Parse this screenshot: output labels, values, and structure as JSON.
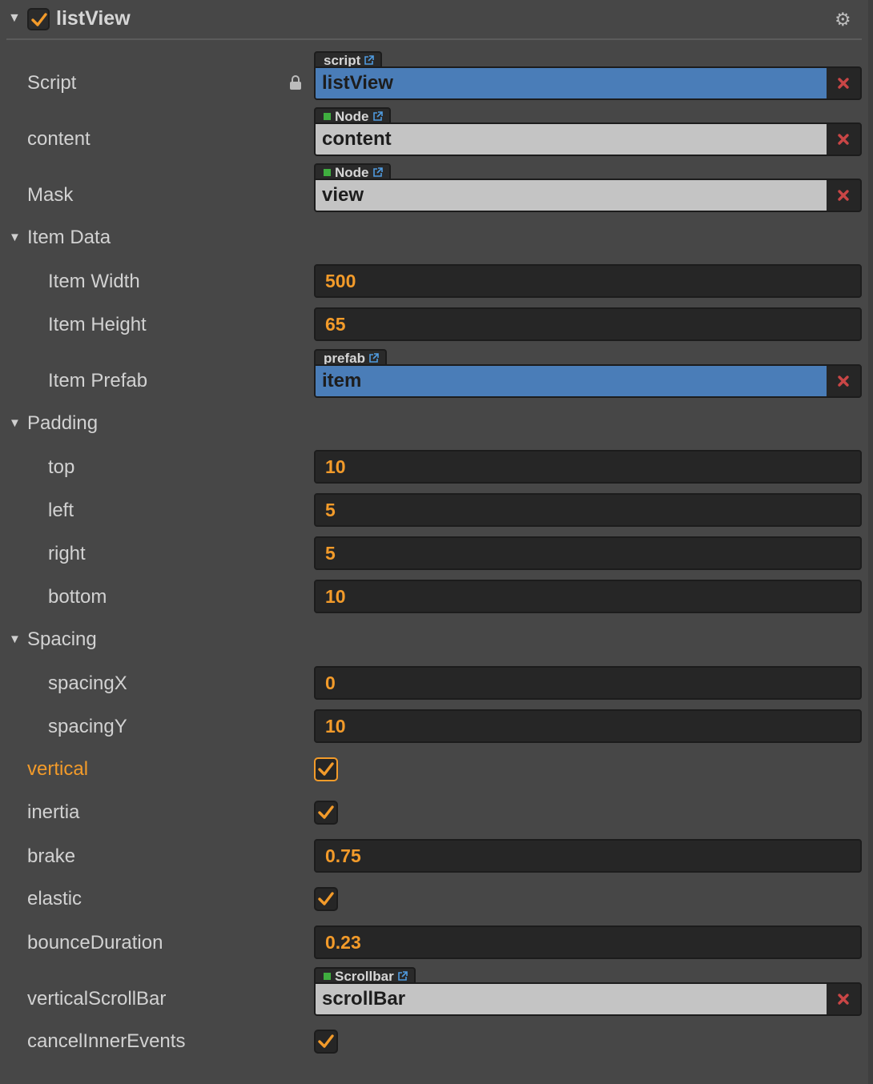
{
  "component": {
    "title": "listView",
    "enabled": true
  },
  "colors": {
    "accent": "#f39b2a",
    "object_ref": "#4a7db8",
    "node_ref": "#c4c4c4",
    "remove": "#c94646"
  },
  "properties": {
    "script": {
      "label": "Script",
      "type_label": "script",
      "value": "listView"
    },
    "content": {
      "label": "content",
      "type_label": "Node",
      "value": "content"
    },
    "mask": {
      "label": "Mask",
      "type_label": "Node",
      "value": "view"
    }
  },
  "item_data": {
    "label": "Item Data",
    "item_width": {
      "label": "Item Width",
      "value": "500"
    },
    "item_height": {
      "label": "Item Height",
      "value": "65"
    },
    "item_prefab": {
      "label": "Item Prefab",
      "type_label": "prefab",
      "value": "item"
    }
  },
  "padding": {
    "label": "Padding",
    "top": {
      "label": "top",
      "value": "10"
    },
    "left": {
      "label": "left",
      "value": "5"
    },
    "right": {
      "label": "right",
      "value": "5"
    },
    "bottom": {
      "label": "bottom",
      "value": "10"
    }
  },
  "spacing": {
    "label": "Spacing",
    "spacing_x": {
      "label": "spacingX",
      "value": "0"
    },
    "spacing_y": {
      "label": "spacingY",
      "value": "10"
    }
  },
  "options": {
    "vertical": {
      "label": "vertical",
      "checked": true
    },
    "inertia": {
      "label": "inertia",
      "checked": true
    },
    "brake": {
      "label": "brake",
      "value": "0.75"
    },
    "elastic": {
      "label": "elastic",
      "checked": true
    },
    "bounce_duration": {
      "label": "bounceDuration",
      "value": "0.23"
    },
    "vertical_scroll_bar": {
      "label": "verticalScrollBar",
      "type_label": "Scrollbar",
      "value": "scrollBar"
    },
    "cancel_inner_events": {
      "label": "cancelInnerEvents",
      "checked": true
    }
  },
  "icons": {
    "collapse": "triangle-down-icon",
    "settings": "gear-icon",
    "lock": "lock-icon",
    "external": "external-link-icon",
    "remove": "x-remove-icon",
    "check": "checkmark-icon"
  }
}
